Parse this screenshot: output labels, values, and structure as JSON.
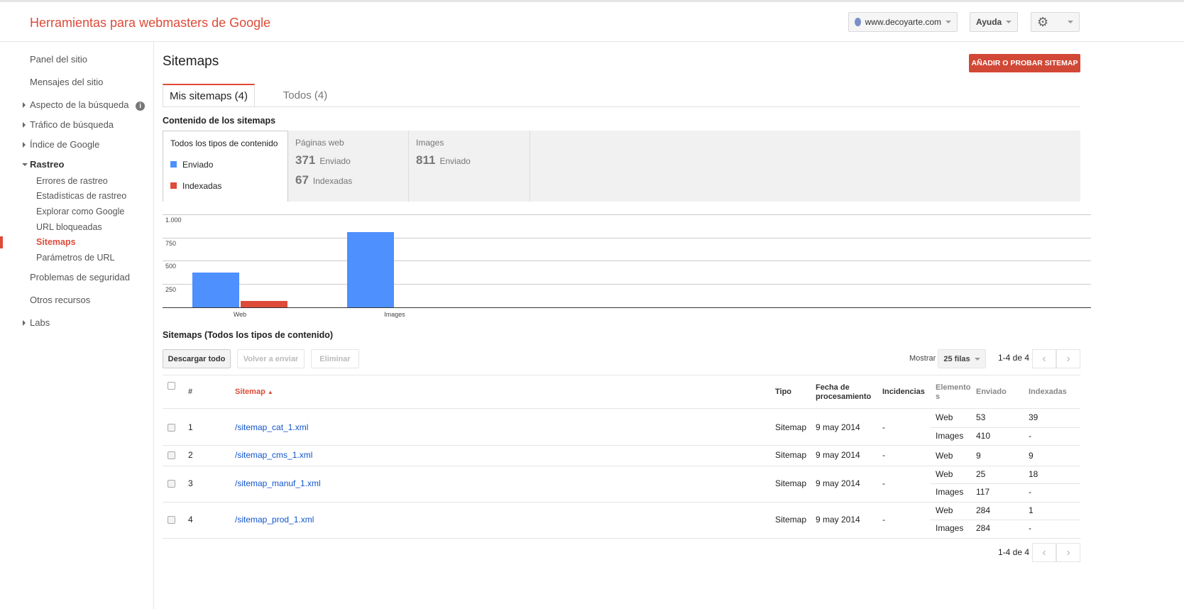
{
  "header": {
    "title": "Herramientas para webmasters de Google",
    "site": "www.decoyarte.com",
    "help": "Ayuda"
  },
  "sidebar": {
    "items": [
      "Panel del sitio",
      "Mensajes del sitio",
      "Aspecto de la búsqueda",
      "Tráfico de búsqueda",
      "Índice de Google",
      "Rastreo",
      "Errores de rastreo",
      "Estadísticas de rastreo",
      "Explorar como Google",
      "URL bloqueadas",
      "Sitemaps",
      "Parámetros de URL",
      "Problemas de seguridad",
      "Otros recursos",
      "Labs"
    ]
  },
  "page": {
    "title": "Sitemaps",
    "add_button": "AÑADIR O PROBAR SITEMAP",
    "tabs": [
      "Mis sitemaps (4)",
      "Todos (4)"
    ],
    "content_heading": "Contenido de los sitemaps",
    "table_heading": "Sitemaps (Todos los tipos de contenido)"
  },
  "cards": {
    "all": {
      "title": "Todos los tipos de contenido",
      "legend_sent": "Enviado",
      "legend_indexed": "Indexadas"
    },
    "web": {
      "title": "Páginas web",
      "sent": "371",
      "sent_label": "Enviado",
      "indexed": "67",
      "indexed_label": "Indexadas"
    },
    "images": {
      "title": "Images",
      "sent": "811",
      "sent_label": "Enviado"
    }
  },
  "colors": {
    "sent": "#4d90fe",
    "indexed": "#dd4b39"
  },
  "chart_data": {
    "type": "bar",
    "categories": [
      "Web",
      "Images"
    ],
    "series": [
      {
        "name": "Enviado",
        "values": [
          371,
          811
        ]
      },
      {
        "name": "Indexadas",
        "values": [
          67,
          0
        ]
      }
    ],
    "yticks": [
      "250",
      "500",
      "750",
      "1.000"
    ],
    "ylim": [
      0,
      1000
    ]
  },
  "toolbar": {
    "download": "Descargar todo",
    "resubmit": "Volver a enviar",
    "delete": "Eliminar",
    "show": "Mostrar",
    "rows": "25 filas",
    "range": "1-4 de 4"
  },
  "table": {
    "headers": [
      "#",
      "Sitemap",
      "Tipo",
      "Fecha de procesamiento",
      "Incidencias",
      "Elementos",
      "Enviado",
      "Indexadas"
    ],
    "rows": [
      {
        "n": "1",
        "name": "/sitemap_cat_1.xml",
        "type": "Sitemap",
        "date": "9 may 2014",
        "issues": "-",
        "items": [
          [
            "Web",
            "53",
            "39"
          ],
          [
            "Images",
            "410",
            "-"
          ]
        ]
      },
      {
        "n": "2",
        "name": "/sitemap_cms_1.xml",
        "type": "Sitemap",
        "date": "9 may 2014",
        "issues": "-",
        "items": [
          [
            "Web",
            "9",
            "9"
          ]
        ]
      },
      {
        "n": "3",
        "name": "/sitemap_manuf_1.xml",
        "type": "Sitemap",
        "date": "9 may 2014",
        "issues": "-",
        "items": [
          [
            "Web",
            "25",
            "18"
          ],
          [
            "Images",
            "117",
            "-"
          ]
        ]
      },
      {
        "n": "4",
        "name": "/sitemap_prod_1.xml",
        "type": "Sitemap",
        "date": "9 may 2014",
        "issues": "-",
        "items": [
          [
            "Web",
            "284",
            "1"
          ],
          [
            "Images",
            "284",
            "-"
          ]
        ]
      }
    ]
  }
}
